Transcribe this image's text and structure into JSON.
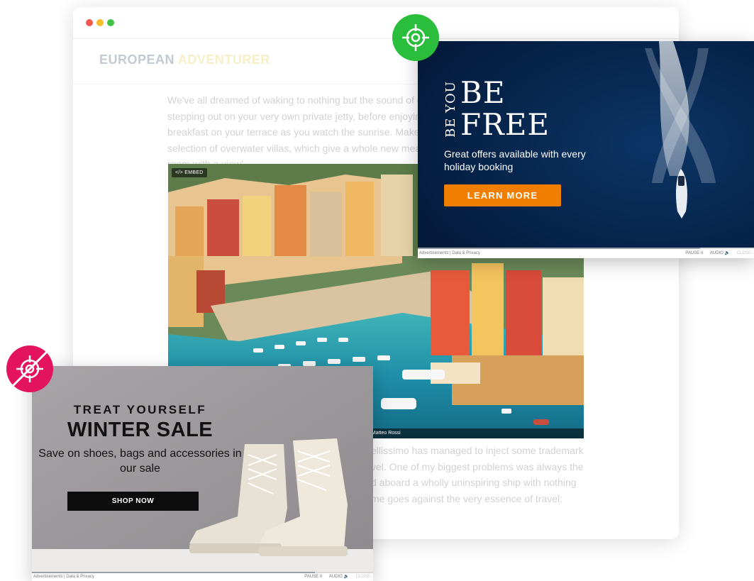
{
  "browser": {
    "brand_part1": "EUROPEAN",
    "brand_part2": "ADVENTURER",
    "intro_text": "We've all dreamed of waking to nothing but the sound of crashing waves, stepping out on your very own private jetty, before enjoying freshly prepared breakfast on your terrace as you watch the sunrise. Make it a reality with our selection of overwater villas, which give a whole new meaning to the term: 'a room with a view'.",
    "embed_label": "</> EMBED",
    "photo_credit": ": Matteo Rossi",
    "outro_text": "ellissimo has managed to inject some trademark vel. One of my biggest problems was always the d aboard a wholly uninspiring ship with nothing me goes against the very essence of travel:"
  },
  "ad_top": {
    "vertical_text": "BE YOU",
    "headline_1": "BE",
    "headline_2": "FREE",
    "offer_text": "Great offers available with every holiday booking",
    "cta_label": "LEARN MORE",
    "footer_left": "Advertisements | Data & Privacy",
    "pause_label": "PAUSE II",
    "audio_label": "AUDIO 🔈",
    "close_label": "CLOSE",
    "progress": 0.84,
    "cta_color": "#f07e00",
    "bg_color": "#06224a"
  },
  "ad_bottom": {
    "kicker": "TREAT YOURSELF",
    "headline": "WINTER SALE",
    "body_text": "Save on shoes, bags and accessories in our sale",
    "cta_label": "SHOP NOW",
    "footer_left": "Advertisements | Data & Privacy",
    "pause_label": "PAUSE II",
    "audio_label": "AUDIO 🔈",
    "close_label": "CLOSE",
    "progress": 0.83
  },
  "icons": {
    "green_target": "crosshair-target-icon",
    "pink_target": "crosshair-target-blocked-icon"
  },
  "colors": {
    "green_badge": "#2bbe3c",
    "pink_badge": "#e3145d"
  }
}
